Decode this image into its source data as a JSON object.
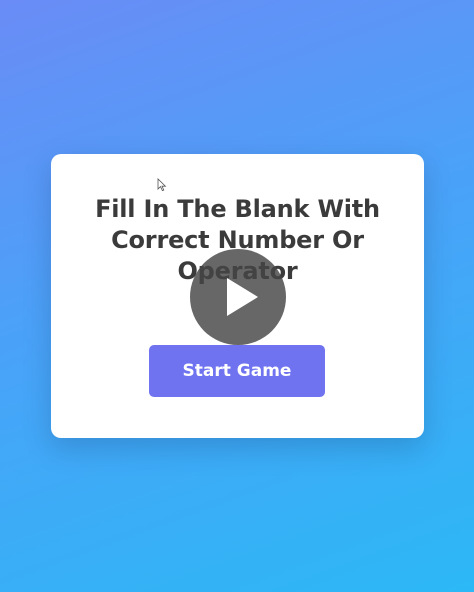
{
  "card": {
    "title": "Fill In The Blank With Correct Number Or Operator",
    "start_button_label": "Start Game"
  },
  "overlay": {
    "icon": "play-icon"
  },
  "colors": {
    "background_start": "#6a8cf6",
    "background_end": "#2cb8f6",
    "button": "#6f73f0",
    "title_text": "#3b3b3b",
    "overlay": "#464646"
  }
}
